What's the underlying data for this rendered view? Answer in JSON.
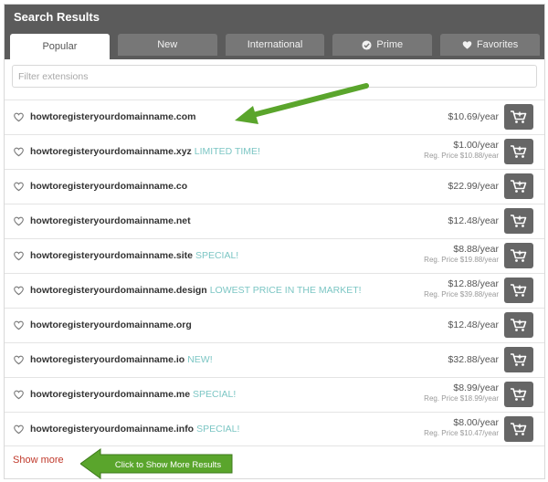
{
  "header": {
    "title": "Search Results"
  },
  "tabs": [
    {
      "label": "Popular",
      "icon": ""
    },
    {
      "label": "New",
      "icon": ""
    },
    {
      "label": "International",
      "icon": ""
    },
    {
      "label": "Prime",
      "icon": "check-circle-icon"
    },
    {
      "label": "Favorites",
      "icon": "heart-icon"
    }
  ],
  "filter": {
    "placeholder": "Filter extensions",
    "value": ""
  },
  "results": [
    {
      "domain": "howtoregisteryourdomainname.com",
      "promo": "",
      "price": "$10.69/year",
      "reg": ""
    },
    {
      "domain": "howtoregisteryourdomainname.xyz",
      "promo": "LIMITED TIME!",
      "price": "$1.00/year",
      "reg": "Reg. Price $10.88/year"
    },
    {
      "domain": "howtoregisteryourdomainname.co",
      "promo": "",
      "price": "$22.99/year",
      "reg": ""
    },
    {
      "domain": "howtoregisteryourdomainname.net",
      "promo": "",
      "price": "$12.48/year",
      "reg": ""
    },
    {
      "domain": "howtoregisteryourdomainname.site",
      "promo": "SPECIAL!",
      "price": "$8.88/year",
      "reg": "Reg. Price $19.88/year"
    },
    {
      "domain": "howtoregisteryourdomainname.design",
      "promo": "LOWEST PRICE IN THE MARKET!",
      "price": "$12.88/year",
      "reg": "Reg. Price $39.88/year"
    },
    {
      "domain": "howtoregisteryourdomainname.org",
      "promo": "",
      "price": "$12.48/year",
      "reg": ""
    },
    {
      "domain": "howtoregisteryourdomainname.io",
      "promo": "NEW!",
      "price": "$32.88/year",
      "reg": ""
    },
    {
      "domain": "howtoregisteryourdomainname.me",
      "promo": "SPECIAL!",
      "price": "$8.99/year",
      "reg": "Reg. Price $18.99/year"
    },
    {
      "domain": "howtoregisteryourdomainname.info",
      "promo": "SPECIAL!",
      "price": "$8.00/year",
      "reg": "Reg. Price $10.47/year"
    }
  ],
  "show_more": "Show more",
  "callout": {
    "text": "Click to Show More Results"
  },
  "colors": {
    "header": "#5b5b5b",
    "tab": "#777777",
    "promo": "#7cc6c4",
    "show_more": "#c0392b",
    "arrow": "#5aa52c",
    "cart": "#666666"
  }
}
